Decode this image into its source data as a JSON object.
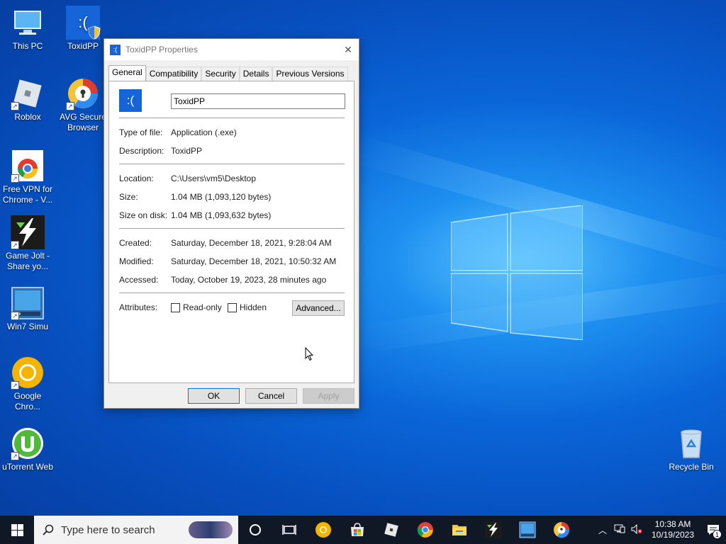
{
  "desktop": {
    "icons": [
      {
        "label": "This PC"
      },
      {
        "label": "ToxidPP"
      },
      {
        "label": "Roblox"
      },
      {
        "label": "AVG Secure Browser"
      },
      {
        "label": "Free VPN for Chrome - V..."
      },
      {
        "label": "Game Jolt - Share yo..."
      },
      {
        "label": "Win7 Simu"
      },
      {
        "label": "Google Chro..."
      },
      {
        "label": "uTorrent Web"
      },
      {
        "label": "Recycle Bin"
      }
    ]
  },
  "dialog": {
    "title": "ToxidPP Properties",
    "icon_glyph": ":(",
    "tabs": [
      "General",
      "Compatibility",
      "Security",
      "Details",
      "Previous Versions"
    ],
    "active_tab": "General",
    "name_value": "ToxidPP",
    "fields": {
      "type_label": "Type of file:",
      "type_value": "Application (.exe)",
      "desc_label": "Description:",
      "desc_value": "ToxidPP",
      "location_label": "Location:",
      "location_value": "C:\\Users\\vm5\\Desktop",
      "size_label": "Size:",
      "size_value": "1.04 MB (1,093,120 bytes)",
      "disk_label": "Size on disk:",
      "disk_value": "1.04 MB (1,093,632 bytes)",
      "created_label": "Created:",
      "created_value": "Saturday, December 18, 2021, 9:28:04 AM",
      "modified_label": "Modified:",
      "modified_value": "Saturday, December 18, 2021, 10:50:32 AM",
      "accessed_label": "Accessed:",
      "accessed_value": "Today, October 19, 2023, 28 minutes ago",
      "attributes_label": "Attributes:"
    },
    "readonly_label": "Read-only",
    "hidden_label": "Hidden",
    "advanced_label": "Advanced...",
    "ok_label": "OK",
    "cancel_label": "Cancel",
    "apply_label": "Apply"
  },
  "taskbar": {
    "search_placeholder": "Type here to search",
    "time": "10:38 AM",
    "date": "10/19/2023",
    "notification_count": "1"
  },
  "colors": {
    "accent": "#0078d7",
    "toxid_blue": "#1565d8",
    "taskbar": "#101826"
  }
}
